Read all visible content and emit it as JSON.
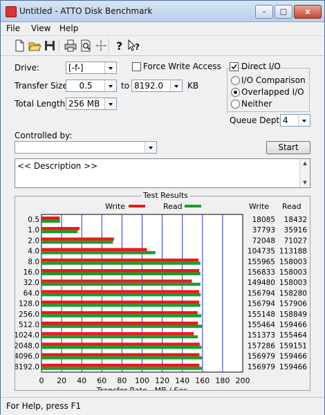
{
  "window": {
    "title": "Untitled - ATTO Disk Benchmark"
  },
  "titlebar_buttons": {
    "minimize": "–",
    "maximize": "□",
    "close": "x"
  },
  "menu": [
    "File",
    "View",
    "Help"
  ],
  "toolbar": {
    "icons": [
      "new-icon",
      "open-icon",
      "save-icon",
      "print-icon",
      "print-preview-icon",
      "move-icon",
      "help-icon",
      "context-help-icon"
    ]
  },
  "form": {
    "drive_label": "Drive:",
    "drive_value": "[-f-]",
    "force_write_label": "Force Write Access",
    "force_write_checked": false,
    "direct_io_label": "Direct I/O",
    "direct_io_checked": true,
    "transfer_size_label": "Transfer Size:",
    "transfer_from": "0.5",
    "to_label": "to",
    "transfer_to": "8192.0",
    "kb_label": "KB",
    "total_length_label": "Total Length:",
    "total_length_value": "256 MB",
    "io_options": [
      {
        "label": "I/O Comparison",
        "selected": false
      },
      {
        "label": "Overlapped I/O",
        "selected": true
      },
      {
        "label": "Neither",
        "selected": false
      }
    ],
    "queue_depth_label": "Queue Depth:",
    "queue_depth_value": "4",
    "controlled_by_label": "Controlled by:",
    "controlled_by_value": "",
    "start_label": "Start",
    "description_text": "<< Description >>"
  },
  "results": {
    "group_title": "Test Results",
    "legend_write": "Write",
    "legend_read": "Read",
    "col_write": "Write",
    "col_read": "Read",
    "write_color": "#e8191b",
    "read_color": "#1f9a2c"
  },
  "chart_data": {
    "type": "bar",
    "orientation": "horizontal",
    "xlabel": "Transfer Rate - MB / Sec",
    "xlim": [
      0,
      200
    ],
    "xticks": [
      0,
      20,
      40,
      60,
      80,
      100,
      120,
      140,
      160,
      180,
      200
    ],
    "categories": [
      "0.5",
      "1.0",
      "2.0",
      "4.0",
      "8.0",
      "16.0",
      "32.0",
      "64.0",
      "128.0",
      "256.0",
      "512.0",
      "1024.0",
      "2048.0",
      "4096.0",
      "8192.0"
    ],
    "series": [
      {
        "name": "Write",
        "color": "#e8191b",
        "values_mb_s": [
          18.085,
          37.793,
          72.048,
          104.735,
          155.965,
          156.833,
          149.48,
          156.794,
          156.794,
          155.148,
          155.464,
          151.373,
          157.286,
          156.979,
          156.979
        ],
        "labels": [
          "18085",
          "37793",
          "72048",
          "104735",
          "155965",
          "156833",
          "149480",
          "156794",
          "156794",
          "155148",
          "155464",
          "151373",
          "157286",
          "156979",
          "156979"
        ]
      },
      {
        "name": "Read",
        "color": "#1f9a2c",
        "values_mb_s": [
          18.432,
          35.916,
          71.027,
          113.188,
          158.003,
          158.003,
          158.003,
          158.28,
          157.906,
          158.849,
          159.466,
          155.464,
          159.151,
          159.466,
          159.466
        ],
        "labels": [
          "18432",
          "35916",
          "71027",
          "113188",
          "158003",
          "158003",
          "158003",
          "158280",
          "157906",
          "158849",
          "159466",
          "155464",
          "159151",
          "159466",
          "159466"
        ]
      }
    ],
    "grid": true
  },
  "status": {
    "text": "For Help, press F1"
  }
}
